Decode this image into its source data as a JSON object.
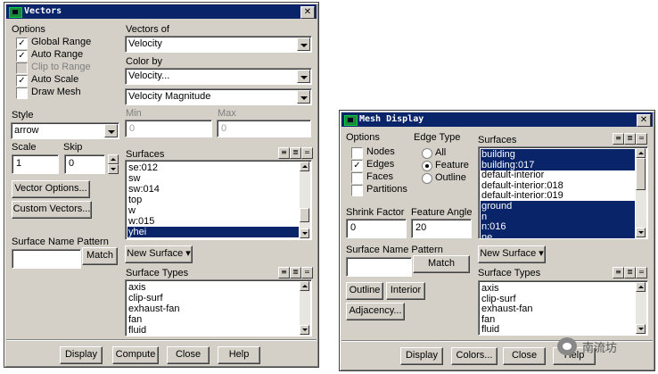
{
  "vectors": {
    "title": "Vectors",
    "options_label": "Options",
    "options": [
      {
        "label": "Global Range",
        "checked": true,
        "enabled": true
      },
      {
        "label": "Auto Range",
        "checked": true,
        "enabled": true
      },
      {
        "label": "Clip to Range",
        "checked": false,
        "enabled": false
      },
      {
        "label": "Auto Scale",
        "checked": true,
        "enabled": true
      },
      {
        "label": "Draw Mesh",
        "checked": false,
        "enabled": true
      }
    ],
    "vectors_of_label": "Vectors of",
    "vectors_of_value": "Velocity",
    "color_by_label": "Color by",
    "color_by_value": "Velocity...",
    "color_by_sub_value": "Velocity Magnitude",
    "min_label": "Min",
    "min_value": "0",
    "max_label": "Max",
    "max_value": "0",
    "style_label": "Style",
    "style_value": "arrow",
    "scale_label": "Scale",
    "scale_value": "1",
    "skip_label": "Skip",
    "skip_value": "0",
    "vector_options_button": "Vector Options...",
    "custom_vectors_button": "Custom Vectors...",
    "surfaces_label": "Surfaces",
    "surfaces": [
      {
        "name": "se:012",
        "selected": false
      },
      {
        "name": "sw",
        "selected": false
      },
      {
        "name": "sw:014",
        "selected": false
      },
      {
        "name": "top",
        "selected": false
      },
      {
        "name": "w",
        "selected": false
      },
      {
        "name": "w:015",
        "selected": false
      },
      {
        "name": "yhei",
        "selected": true
      }
    ],
    "new_surface_button": "New Surface",
    "surface_name_pattern_label": "Surface Name Pattern",
    "surface_name_pattern_value": "",
    "match_button": "Match",
    "surface_types_label": "Surface Types",
    "surface_types": [
      "axis",
      "clip-surf",
      "exhaust-fan",
      "fan",
      "fluid"
    ],
    "buttons": {
      "display": "Display",
      "compute": "Compute",
      "close": "Close",
      "help": "Help"
    }
  },
  "mesh": {
    "title": "Mesh Display",
    "options_label": "Options",
    "options": [
      {
        "label": "Nodes",
        "checked": false
      },
      {
        "label": "Edges",
        "checked": true
      },
      {
        "label": "Faces",
        "checked": false
      },
      {
        "label": "Partitions",
        "checked": false
      }
    ],
    "edge_type_label": "Edge Type",
    "edge_types": [
      {
        "label": "All",
        "selected": false
      },
      {
        "label": "Feature",
        "selected": true
      },
      {
        "label": "Outline",
        "selected": false
      }
    ],
    "surfaces_label": "Surfaces",
    "surfaces": [
      {
        "name": "building",
        "selected": true
      },
      {
        "name": "building:017",
        "selected": true
      },
      {
        "name": "default-interior",
        "selected": false
      },
      {
        "name": "default-interior:018",
        "selected": false
      },
      {
        "name": "default-interior:019",
        "selected": false
      },
      {
        "name": "ground",
        "selected": true
      },
      {
        "name": "n",
        "selected": true
      },
      {
        "name": "n:016",
        "selected": true
      },
      {
        "name": "ne",
        "selected": true
      }
    ],
    "shrink_factor_label": "Shrink Factor",
    "shrink_factor_value": "0",
    "feature_angle_label": "Feature Angle",
    "feature_angle_value": "20",
    "surface_name_pattern_label": "Surface Name Pattern",
    "surface_name_pattern_value": "",
    "match_button": "Match",
    "new_surface_button": "New Surface",
    "outline_button": "Outline",
    "interior_button": "Interior",
    "adjacency_button": "Adjacency...",
    "surface_types_label": "Surface Types",
    "surface_types": [
      "axis",
      "clip-surf",
      "exhaust-fan",
      "fan",
      "fluid"
    ],
    "buttons": {
      "display": "Display",
      "colors": "Colors...",
      "close": "Close",
      "help": "Help"
    }
  },
  "watermark": {
    "text": "南流坊"
  }
}
